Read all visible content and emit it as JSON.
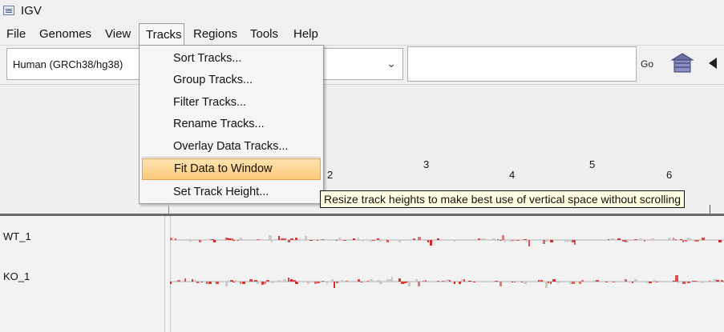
{
  "window": {
    "title": "IGV",
    "icon": "igv-app-icon"
  },
  "menubar": {
    "items": [
      {
        "label": "File"
      },
      {
        "label": "Genomes"
      },
      {
        "label": "View"
      },
      {
        "label": "Tracks"
      },
      {
        "label": "Regions"
      },
      {
        "label": "Tools"
      },
      {
        "label": "Help"
      }
    ]
  },
  "toolbar": {
    "genome": "Human (GRCh38/hg38)",
    "locus_value": "",
    "go_label": "Go",
    "home_icon": "home-icon",
    "back_icon": "back-arrow-icon"
  },
  "tracks_menu": {
    "items": [
      {
        "label": "Sort Tracks..."
      },
      {
        "label": "Group Tracks..."
      },
      {
        "label": "Filter Tracks..."
      },
      {
        "label": "Rename Tracks..."
      },
      {
        "label": "Overlay Data Tracks..."
      },
      {
        "label": "Fit Data to Window",
        "highlighted": true
      },
      {
        "label": "Set Track Height..."
      }
    ]
  },
  "tooltip": {
    "text": "Resize track heights to make best use of vertical space without scrolling"
  },
  "ruler": {
    "chromosomes": [
      "2",
      "3",
      "4",
      "5",
      "6"
    ]
  },
  "tracks": [
    {
      "name": "WT_1",
      "color": "#d42020"
    },
    {
      "name": "KO_1",
      "color": "#d42020"
    }
  ]
}
